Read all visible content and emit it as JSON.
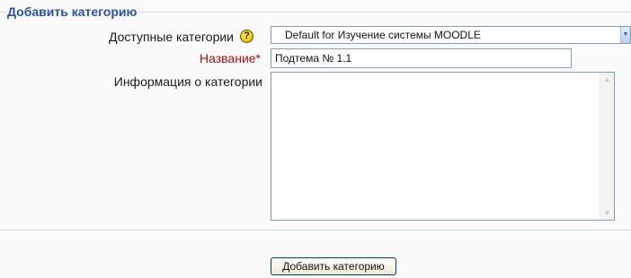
{
  "form": {
    "legend": "Добавить категорию",
    "fields": {
      "parent": {
        "label": "Доступные категории",
        "help_icon": "question-help-icon",
        "selected": "Default for Изучение системы MOODLE",
        "arrow_glyph": "▼"
      },
      "name": {
        "label": "Название",
        "required_mark": "*",
        "value": "Подтема № 1.1"
      },
      "info": {
        "label": "Информация о категории",
        "value": ""
      }
    },
    "submit_label": "Добавить категорию"
  },
  "colors": {
    "legend": "#2952a3",
    "required_label": "#aa1111",
    "input_border": "#7f9db9",
    "background": "#fafafa"
  }
}
